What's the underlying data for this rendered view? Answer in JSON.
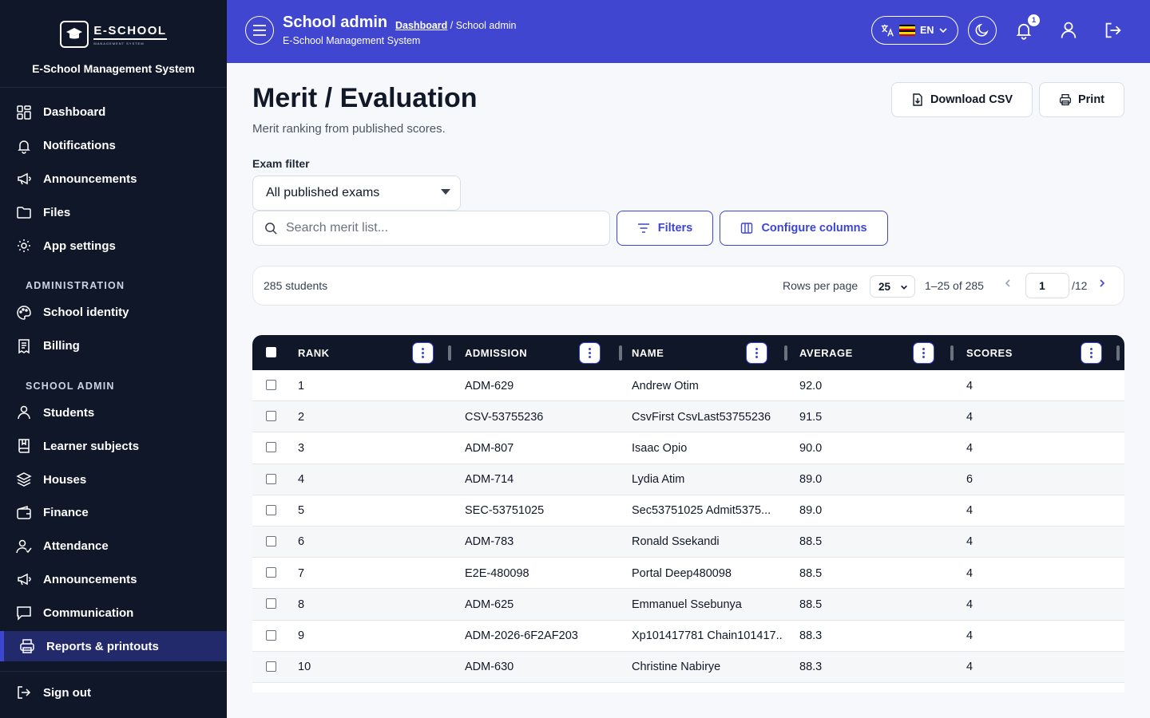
{
  "sidebar": {
    "logo_title": "E-SCHOOL",
    "logo_sub": "MANAGEMENT SYSTEM",
    "system_name": "E-School Management System",
    "items_top": [
      {
        "label": "Dashboard",
        "icon": "dashboard-icon"
      },
      {
        "label": "Notifications",
        "icon": "bell-icon"
      },
      {
        "label": "Announcements",
        "icon": "megaphone-icon"
      },
      {
        "label": "Files",
        "icon": "folder-icon"
      },
      {
        "label": "App settings",
        "icon": "gear-icon"
      }
    ],
    "section_admin": "ADMINISTRATION",
    "items_admin": [
      {
        "label": "School identity",
        "icon": "palette-icon"
      },
      {
        "label": "Billing",
        "icon": "receipt-icon"
      }
    ],
    "section_school": "SCHOOL ADMIN",
    "items_school": [
      {
        "label": "Students",
        "icon": "user-icon"
      },
      {
        "label": "Learner subjects",
        "icon": "book-icon"
      },
      {
        "label": "Houses",
        "icon": "layers-icon"
      },
      {
        "label": "Finance",
        "icon": "wallet-icon"
      },
      {
        "label": "Attendance",
        "icon": "user-check-icon"
      },
      {
        "label": "Announcements",
        "icon": "megaphone-icon"
      },
      {
        "label": "Communication",
        "icon": "chat-icon"
      },
      {
        "label": "Reports & printouts",
        "icon": "printer-icon"
      }
    ],
    "signout": "Sign out"
  },
  "topbar": {
    "title": "School admin",
    "breadcrumb_link": "Dashboard",
    "breadcrumb_rest": " / School admin",
    "subtitle": "E-School Management System",
    "lang": "EN",
    "notification_count": "1"
  },
  "page": {
    "title": "Merit / Evaluation",
    "description": "Merit ranking from published scores.",
    "download_csv": "Download CSV",
    "print": "Print",
    "exam_filter_label": "Exam filter",
    "exam_filter_value": "All published exams",
    "search_placeholder": "Search merit list...",
    "filters": "Filters",
    "configure_columns": "Configure columns"
  },
  "pager": {
    "count": "285 students",
    "rows_per_page_label": "Rows per page",
    "rows_per_page": "25",
    "range": "1–25 of 285",
    "page": "1",
    "total_pages": "/12"
  },
  "table": {
    "columns": [
      "RANK",
      "ADMISSION",
      "NAME",
      "AVERAGE",
      "SCORES"
    ],
    "rows": [
      [
        "1",
        "ADM-629",
        "Andrew Otim",
        "92.0",
        "4"
      ],
      [
        "2",
        "CSV-53755236",
        "CsvFirst CsvLast53755236",
        "91.5",
        "4"
      ],
      [
        "3",
        "ADM-807",
        "Isaac Opio",
        "90.0",
        "4"
      ],
      [
        "4",
        "ADM-714",
        "Lydia Atim",
        "89.0",
        "6"
      ],
      [
        "5",
        "SEC-53751025",
        "Sec53751025 Admit5375...",
        "89.0",
        "4"
      ],
      [
        "6",
        "ADM-783",
        "Ronald Ssekandi",
        "88.5",
        "4"
      ],
      [
        "7",
        "E2E-480098",
        "Portal Deep480098",
        "88.5",
        "4"
      ],
      [
        "8",
        "ADM-625",
        "Emmanuel Ssebunya",
        "88.5",
        "4"
      ],
      [
        "9",
        "ADM-2026-6F2AF203",
        "Xp101417781 Chain101417...",
        "88.3",
        "4"
      ],
      [
        "10",
        "ADM-630",
        "Christine Nabirye",
        "88.3",
        "4"
      ]
    ]
  },
  "colors": {
    "sidebar_bg": "#0f1729",
    "topbar_bg": "#4046d0",
    "accent": "#3b46d1",
    "active_item_bg": "#232a6b"
  }
}
